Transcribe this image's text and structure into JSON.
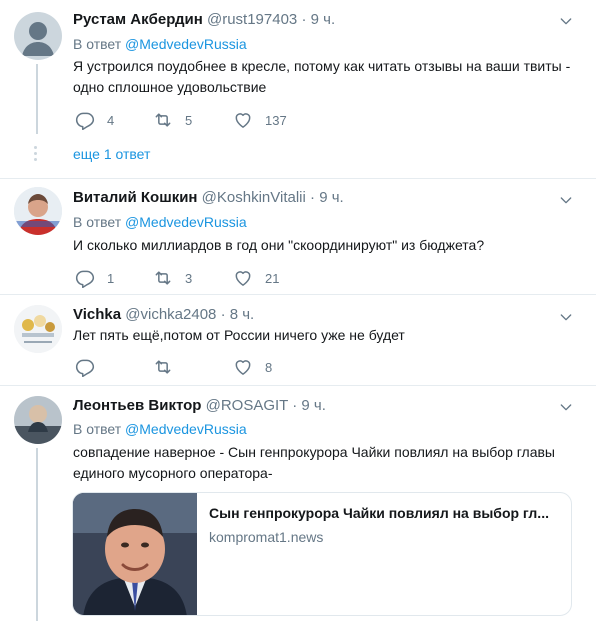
{
  "tweets": [
    {
      "name": "Рустам Акбердин",
      "handle": "@rust197403",
      "time": "9 ч.",
      "reply_prefix": "В ответ",
      "reply_to": "@MedvedevRussia",
      "text": "Я устроился поудобнее в кресле, потому как читать отзывы на ваши твиты - одно сплошное удовольствие",
      "replies": "4",
      "retweets": "5",
      "likes": "137",
      "more_replies": "еще 1 ответ"
    },
    {
      "name": "Виталий Кошкин",
      "handle": "@KoshkinVitalii",
      "time": "9 ч.",
      "reply_prefix": "В ответ",
      "reply_to": "@MedvedevRussia",
      "text": "И сколько миллиардов в год они \"скоординируют\" из бюджета?",
      "replies": "1",
      "retweets": "3",
      "likes": "21"
    },
    {
      "name": "Vichka",
      "handle": "@vichka2408",
      "time": "8 ч.",
      "text": "Лет пять ещё,потом от России ничего уже не будет",
      "likes": "8"
    },
    {
      "name": "Леонтьев Виктор",
      "handle": "@ROSAGIT",
      "time": "9 ч.",
      "reply_prefix": "В ответ",
      "reply_to": "@MedvedevRussia",
      "text": "совпадение наверное - Сын генпрокурора Чайки повлиял на выбор главы единого мусорного оператора-",
      "card": {
        "title": "Сын генпрокурора Чайки повлиял на выбор гл...",
        "domain": "kompromat1.news"
      }
    }
  ],
  "sep": "·"
}
